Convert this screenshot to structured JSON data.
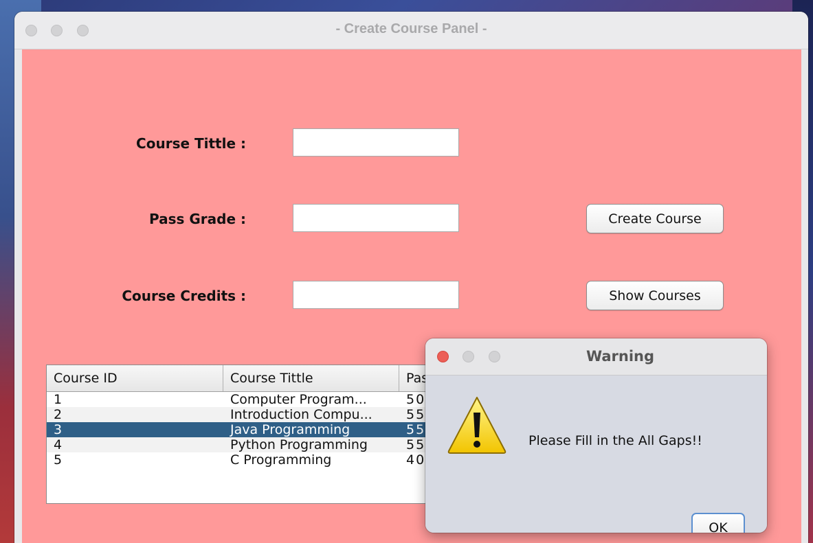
{
  "window": {
    "title": "- Create Course Panel -"
  },
  "form": {
    "course_title_label": "Course Tittle :",
    "pass_grade_label": "Pass Grade :",
    "course_credits_label": "Course Credits :",
    "course_title_value": "",
    "pass_grade_value": "",
    "course_credits_value": "",
    "create_button": "Create Course",
    "show_button": "Show Courses"
  },
  "table": {
    "headers": [
      "Course ID",
      "Course Tittle",
      "Pass"
    ],
    "rows": [
      [
        "1",
        "Computer Program...",
        "50"
      ],
      [
        "2",
        "Introduction Compu...",
        "55"
      ],
      [
        "3",
        "Java Programming",
        "55"
      ],
      [
        "4",
        "Python Programming",
        "55"
      ],
      [
        "5",
        "C Programming",
        "40"
      ]
    ],
    "selected_row_index": 2
  },
  "dialog": {
    "title": "Warning",
    "message": "Please Fill in the All Gaps!!",
    "ok_button": "OK",
    "icon": "warning-icon"
  },
  "colors": {
    "panel_background": "#ff9999",
    "selected_row": "#2f5f87",
    "close_red": "#ec5f57"
  }
}
